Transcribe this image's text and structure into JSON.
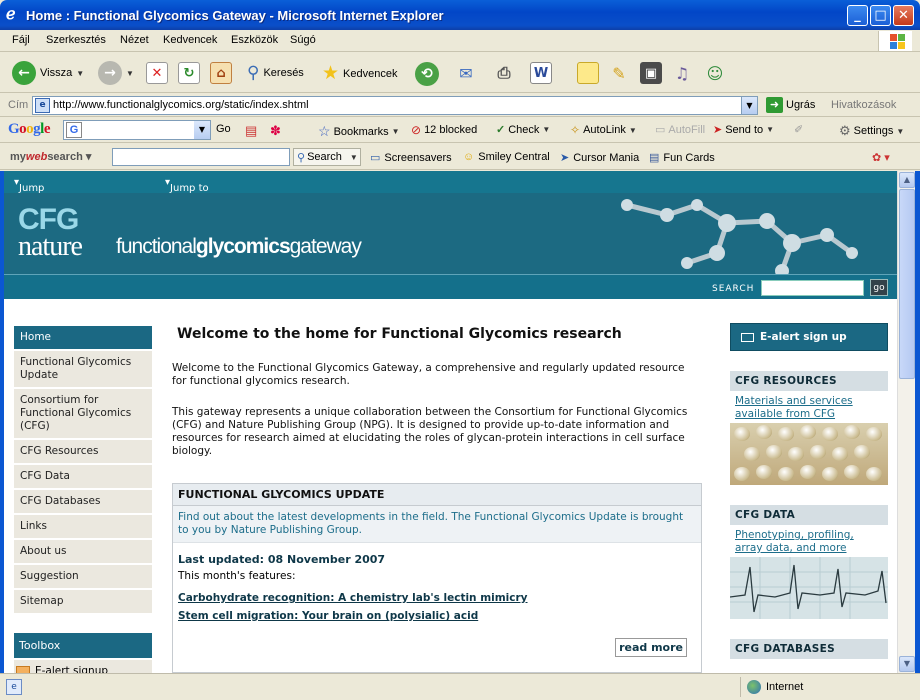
{
  "window": {
    "title": "Home : Functional Glycomics Gateway - Microsoft Internet Explorer",
    "buttons": [
      "_",
      "□",
      "✕"
    ]
  },
  "menu": [
    "Fájl",
    "Szerkesztés",
    "Nézet",
    "Kedvencek",
    "Eszközök",
    "Súgó"
  ],
  "toolbar": {
    "back": "Vissza",
    "search": "Keresés",
    "favorites": "Kedvencek"
  },
  "address": {
    "label": "Cím",
    "url": "http://www.functionalglycomics.org/static/index.shtml",
    "go": "Ugrás",
    "links": "Hivatkozások"
  },
  "google_toolbar": {
    "logo": "Google",
    "go": "Go",
    "bookmarks": "Bookmarks",
    "blocked": "12 blocked",
    "check": "Check",
    "autolink": "AutoLink",
    "autofill": "AutoFill",
    "sendto": "Send to",
    "settings": "Settings"
  },
  "mws_toolbar": {
    "logo_my": "my",
    "logo_web": "web",
    "logo_search": "search",
    "search": "Search",
    "items": [
      "Screensavers",
      "Smiley Central",
      "Cursor Mania",
      "Fun Cards"
    ]
  },
  "page": {
    "skip_links": [
      "Jump to main content",
      "Jump to navigation"
    ],
    "banner": {
      "cfg": "CFG",
      "nature": "nature",
      "gw_pre": "functional",
      "gw_bold": "glycomics",
      "gw_post": "gateway"
    },
    "search_label": "SEARCH",
    "search_go": "go",
    "nav": [
      "Home",
      "Functional Glycomics Update",
      "Consortium for Functional Glycomics (CFG)",
      "CFG Resources",
      "CFG Data",
      "CFG Databases",
      "Links",
      "About us",
      "Suggestion",
      "Sitemap"
    ],
    "toolbox": {
      "title": "Toolbox",
      "ealert": "E-alert signup"
    },
    "main": {
      "heading": "Welcome to the home for Functional Glycomics research",
      "p1": "Welcome to the Functional Glycomics Gateway, a comprehensive and regularly updated resource for functional glycomics research.",
      "p2": "This gateway represents a unique collaboration between the Consortium for Functional Glycomics (CFG) and Nature Publishing Group (NPG). It is designed to provide up-to-date information and resources for research aimed at elucidating the roles of glycan-protein interactions in cell surface biology.",
      "update": {
        "title": "FUNCTIONAL GLYCOMICS UPDATE",
        "intro": "Find out about the latest developments in the field. The Functional Glycomics Update is brought to you by Nature Publishing Group.",
        "last_updated": "Last updated: 08 November 2007",
        "features_label": "This month's features:",
        "articles": [
          "Carbohydrate recognition: A chemistry lab's lectin mimicry",
          "Stem cell migration: Your brain on (polysialic) acid"
        ],
        "read_more": "read more"
      }
    },
    "right": {
      "ealert": "E-alert sign up",
      "boxes": [
        {
          "title": "CFG RESOURCES",
          "link": "Materials and services available from CFG"
        },
        {
          "title": "CFG DATA",
          "link": "Phenotyping, profiling, array data, and more"
        },
        {
          "title": "CFG DATABASES",
          "link": ""
        }
      ]
    }
  },
  "status": {
    "zone": "Internet"
  },
  "colors": {
    "teal": "#1b6883",
    "nav_bg": "#ebe8df",
    "link": "#1c6d8a"
  }
}
